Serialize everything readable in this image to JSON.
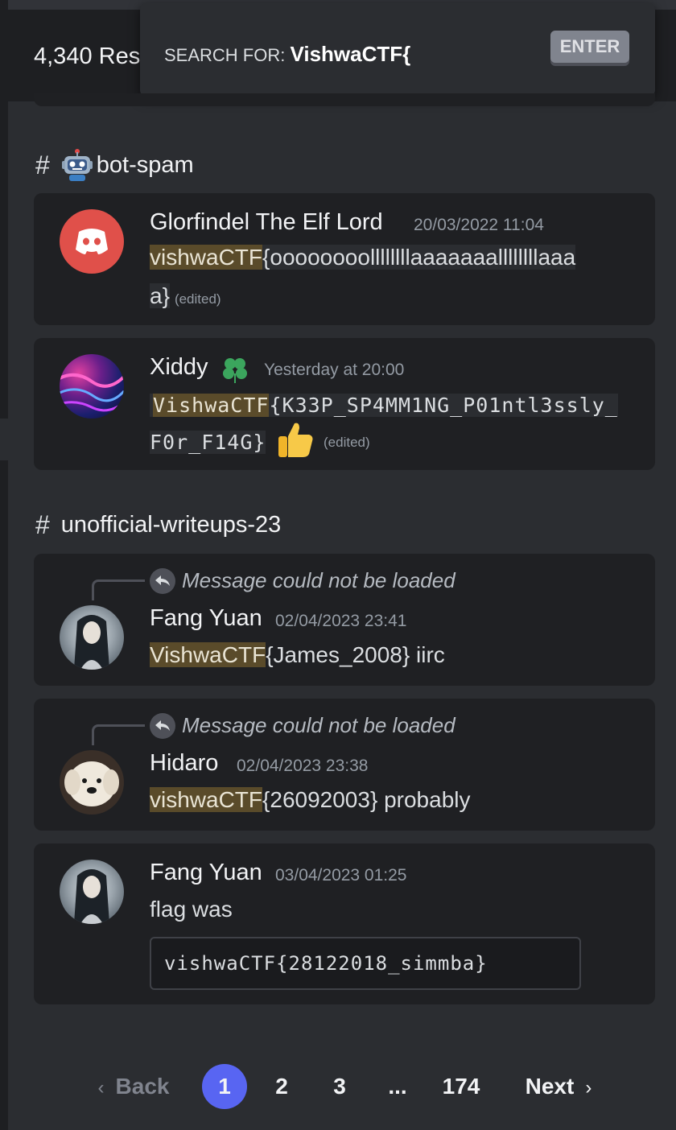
{
  "header": {
    "results_count": "4,340 Res",
    "search_prefix": "SEARCH FOR:",
    "search_query": "VishwaCTF{",
    "enter_label": "ENTER"
  },
  "channels": [
    {
      "name": "bot-spam",
      "messages": [
        {
          "author": "Glorfindel The Elf Lord",
          "timestamp": "20/03/2022 11:04",
          "match": "vishwaCTF",
          "line1": "{oooooooollllllllaaaaaaallllllllaaa",
          "line2": "a}",
          "edited": "(edited)"
        },
        {
          "author": "Xiddy",
          "timestamp": "Yesterday at 20:00",
          "match": "VishwaCTF",
          "line1": "{K33P_SP4MM1NG_P01ntl3ssly_",
          "line2": "F0r_F14G}",
          "edited": "(edited)"
        }
      ]
    },
    {
      "name": "unofficial-writeups-23",
      "messages": [
        {
          "reply_text": "Message could not be loaded",
          "author": "Fang Yuan",
          "timestamp": "02/04/2023 23:41",
          "match": "VishwaCTF",
          "rest": "{James_2008} iirc"
        },
        {
          "reply_text": "Message could not be loaded",
          "author": "Hidaro",
          "timestamp": "02/04/2023 23:38",
          "match": "vishwaCTF",
          "rest": "{26092003} probably"
        },
        {
          "author": "Fang Yuan",
          "timestamp": "03/04/2023 01:25",
          "text": "flag was",
          "code": "vishwaCTF{28122018_simmba}"
        }
      ]
    }
  ],
  "pagination": {
    "back": "Back",
    "pages": [
      "1",
      "2",
      "3",
      "...",
      "174"
    ],
    "current": "1",
    "next": "Next"
  },
  "colors": {
    "highlight": "#5a4b2a",
    "active_page": "#5865f2",
    "discord_red": "#e0504a"
  }
}
